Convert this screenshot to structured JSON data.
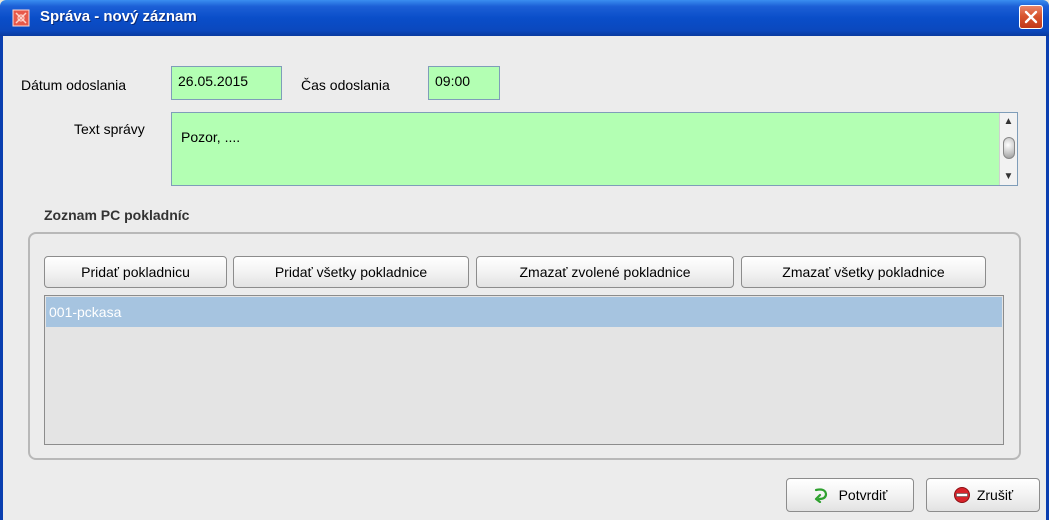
{
  "window": {
    "title": "Správa - nový záznam"
  },
  "form": {
    "date_label": "Dátum odoslania",
    "date_value": "26.05.2015",
    "time_label": "Čas odoslania",
    "time_value": "09:00",
    "message_label": "Text správy",
    "message_value": "Pozor, ...."
  },
  "cash_registers": {
    "group_title": "Zoznam PC pokladníc",
    "buttons": {
      "add": "Pridať pokladnicu",
      "add_all": "Pridať všetky pokladnice",
      "delete_selected": "Zmazať zvolené pokladnice",
      "delete_all": "Zmazať všetky pokladnice"
    },
    "items": [
      "001-pckasa"
    ]
  },
  "footer": {
    "confirm": "Potvrdiť",
    "cancel": "Zrušiť"
  },
  "colors": {
    "field_bg": "#b3ffb3",
    "selection_bg": "#a6c4e0",
    "titlebar": "#0a4ec9"
  },
  "icons": {
    "title": "app-icon",
    "close": "close-icon",
    "confirm": "confirm-arrow-icon",
    "cancel": "cancel-stop-icon"
  }
}
